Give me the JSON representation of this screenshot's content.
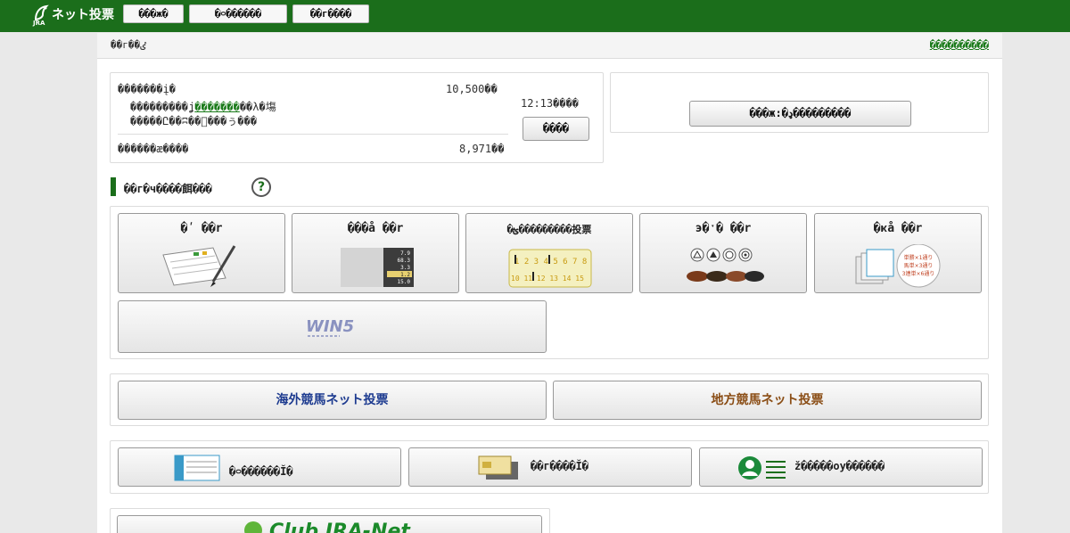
{
  "header": {
    "logo_small": "JRA",
    "logo_title": "ネット投票",
    "nav": [
      {
        "label": "���ж�"
      },
      {
        "label": "�࿁������"
      },
      {
        "label": "��г����"
      }
    ]
  },
  "subheader": {
    "title": "��г��ٸ",
    "link": "����������"
  },
  "account": {
    "line1": "�������į�",
    "amount1": "10,500��",
    "line2_pre": "���������ʝ͏",
    "line2_link": "�������",
    "line2_post": "��λ�塲",
    "line3": "�����Ը��ʭ��⃞���ぅ���",
    "time": "12:13����",
    "refresh_button": "����",
    "line4": "������æ����",
    "amount2": "8,971��"
  },
  "side_panel": {
    "button": "���ж:�ډ���������"
  },
  "section": {
    "title": "��г�ч����餌���",
    "help": "?"
  },
  "tiles": [
    {
      "label": "�ʹ ��r"
    },
    {
      "label": "���å ��r"
    },
    {
      "label": "�ؿ���������投票"
    },
    {
      "label": "э�ˑ� ��r"
    },
    {
      "label": "�ҝå ��r"
    }
  ],
  "win5": {
    "label": "WIN5"
  },
  "overseas": {
    "label": "海外競馬ネット投票",
    "color": "#1c3a8f"
  },
  "local": {
    "label": "地方競馬ネット投票",
    "color": "#8a4d15"
  },
  "links": [
    {
      "label": "�࿁������Ĭ�"
    },
    {
      "label": "��г����Ĭ�"
    },
    {
      "label": "ž�����оу������"
    }
  ],
  "club": {
    "label": "Club JRA-Net"
  }
}
